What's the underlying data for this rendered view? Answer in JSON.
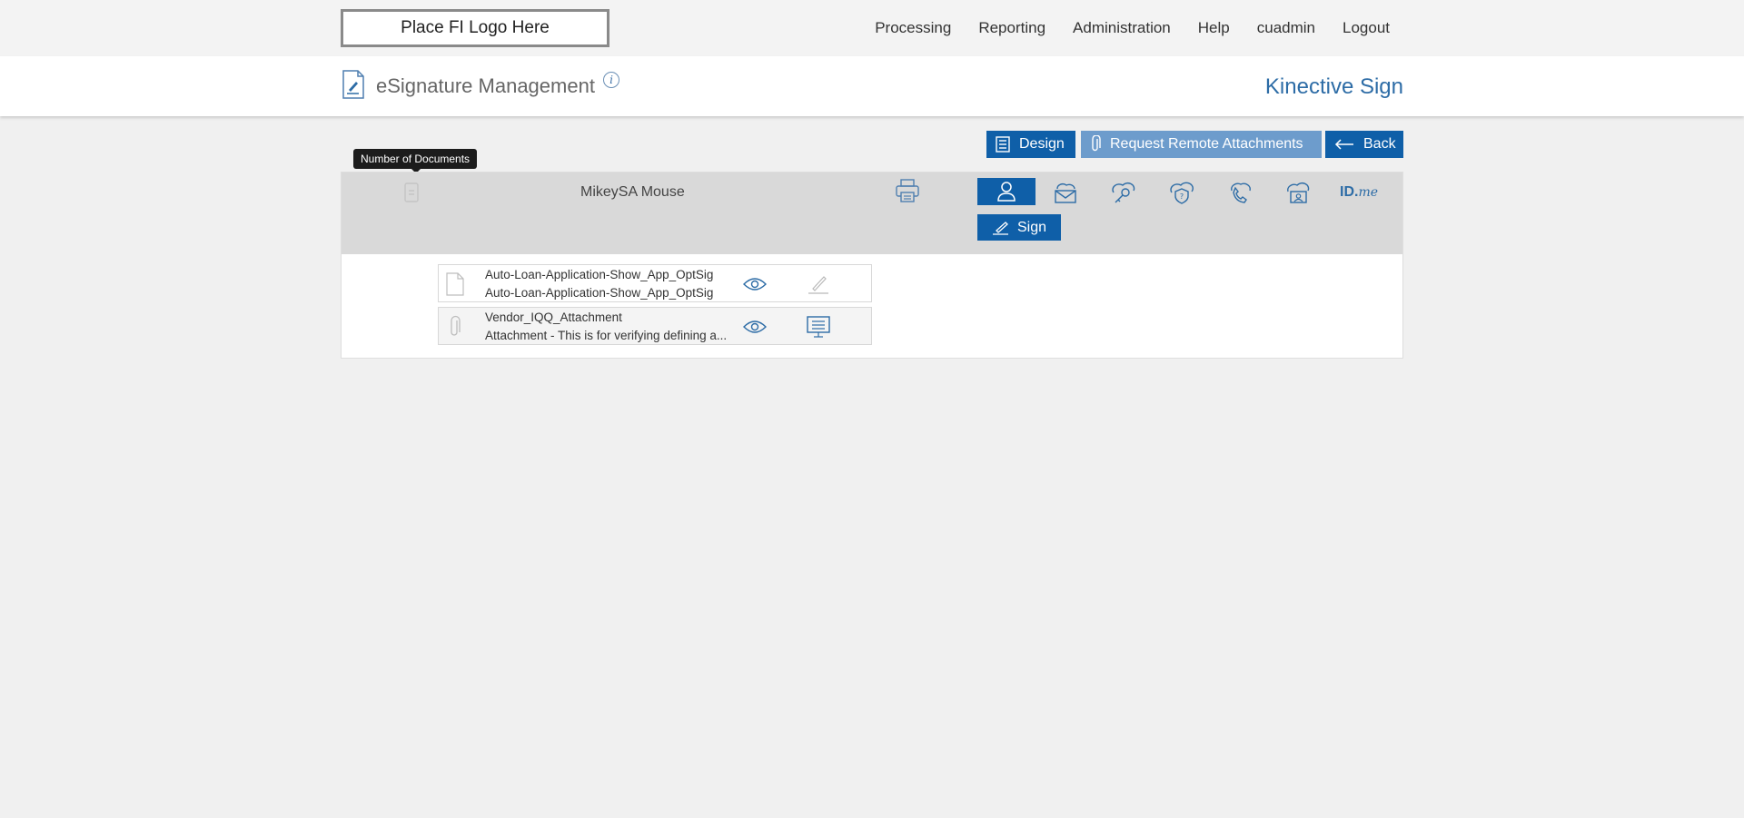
{
  "topbar": {
    "logo_text": "Place FI Logo Here",
    "nav": [
      "Processing",
      "Reporting",
      "Administration",
      "Help",
      "cuadmin",
      "Logout"
    ]
  },
  "header": {
    "title": "eSignature Management",
    "info_icon": "info-icon",
    "info_glyph": "i",
    "brand": "Kinective Sign"
  },
  "actions": {
    "design_label": "Design",
    "request_label": "Request Remote Attachments",
    "back_label": "Back"
  },
  "tooltip": "Number of Documents",
  "signer": {
    "name": "MikeySA Mouse",
    "sign_label": "Sign",
    "auth_methods": [
      "in-person-icon",
      "email-icon",
      "key-icon",
      "security-question-icon",
      "phone-icon",
      "id-card-icon",
      "idme-icon"
    ],
    "idme_text": "ID.",
    "idme_suffix": "me"
  },
  "documents": [
    {
      "type": "document-icon",
      "line1": "Auto-Loan-Application-Show_App_OptSig",
      "line2": "Auto-Loan-Application-Show_App_OptSig",
      "action": "sign-icon"
    },
    {
      "type": "attachment-icon",
      "line1": "Vendor_IQQ_Attachment",
      "line2": "Attachment - This is for verifying defining a...",
      "action": "monitor-icon"
    }
  ],
  "colors": {
    "primary": "#0f5fa8",
    "light_primary": "#6d9ccc",
    "brand": "#2d6ca6",
    "band": "#d9d9d9",
    "bg": "#f0f0f0"
  }
}
